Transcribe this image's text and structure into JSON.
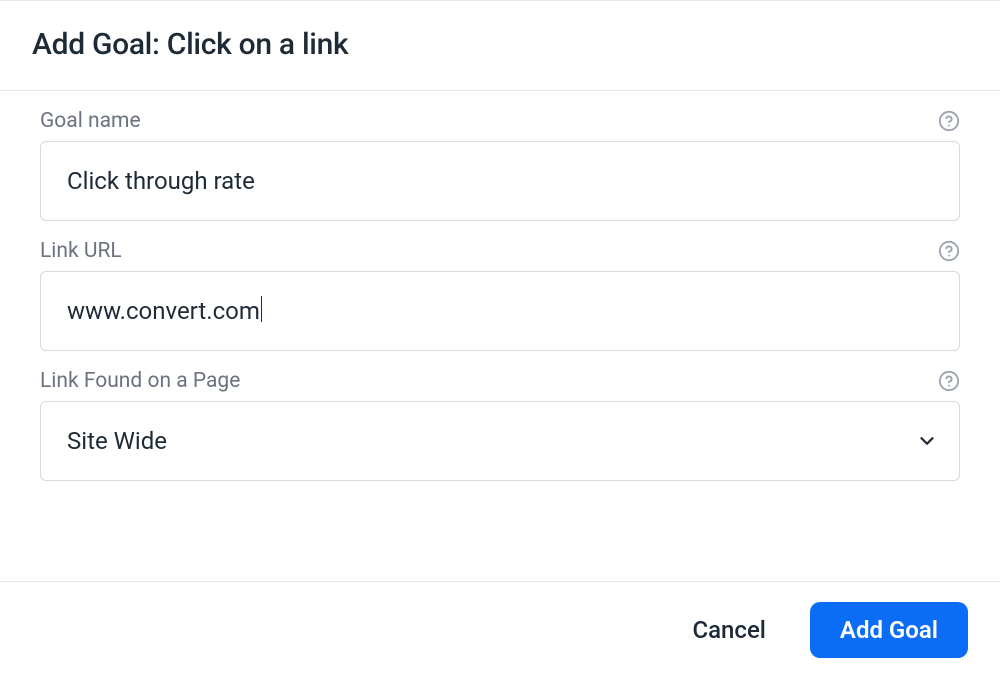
{
  "dialog": {
    "title": "Add Goal: Click on a link"
  },
  "fields": {
    "goal_name": {
      "label": "Goal name",
      "value": "Click through rate"
    },
    "link_url": {
      "label": "Link URL",
      "value": "www.convert.com"
    },
    "link_found": {
      "label": "Link Found on a Page",
      "selected": "Site Wide"
    }
  },
  "footer": {
    "cancel_label": "Cancel",
    "submit_label": "Add Goal"
  }
}
